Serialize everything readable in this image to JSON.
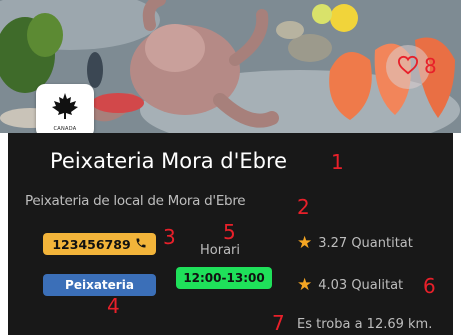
{
  "shop": {
    "name": "Peixateria Mora d'Ebre",
    "description": "Peixateria de local de Mora d'Ebre",
    "phone": "123456789",
    "category": "Peixateria",
    "hours_label": "Horari",
    "hours": "12:00-13:00",
    "quantity_rating": "3.27 Quantitat",
    "quality_rating": "4.03 Qualitat",
    "distance": "Es troba a 12.69 km."
  },
  "annotations": [
    "1",
    "2",
    "3",
    "4",
    "5",
    "6",
    "7",
    "8"
  ],
  "icons": {
    "logo": "maple-leaf-icon",
    "favorite": "heart-icon",
    "phone": "phone-icon",
    "star": "star-icon"
  },
  "colors": {
    "panel_bg": "#181818",
    "phone_badge": "#f2b43a",
    "category_badge": "#3b6fb8",
    "hours_badge": "#1fe05a",
    "star": "#f5a623",
    "annotation": "#e8202a",
    "heart": "#e8202a"
  }
}
